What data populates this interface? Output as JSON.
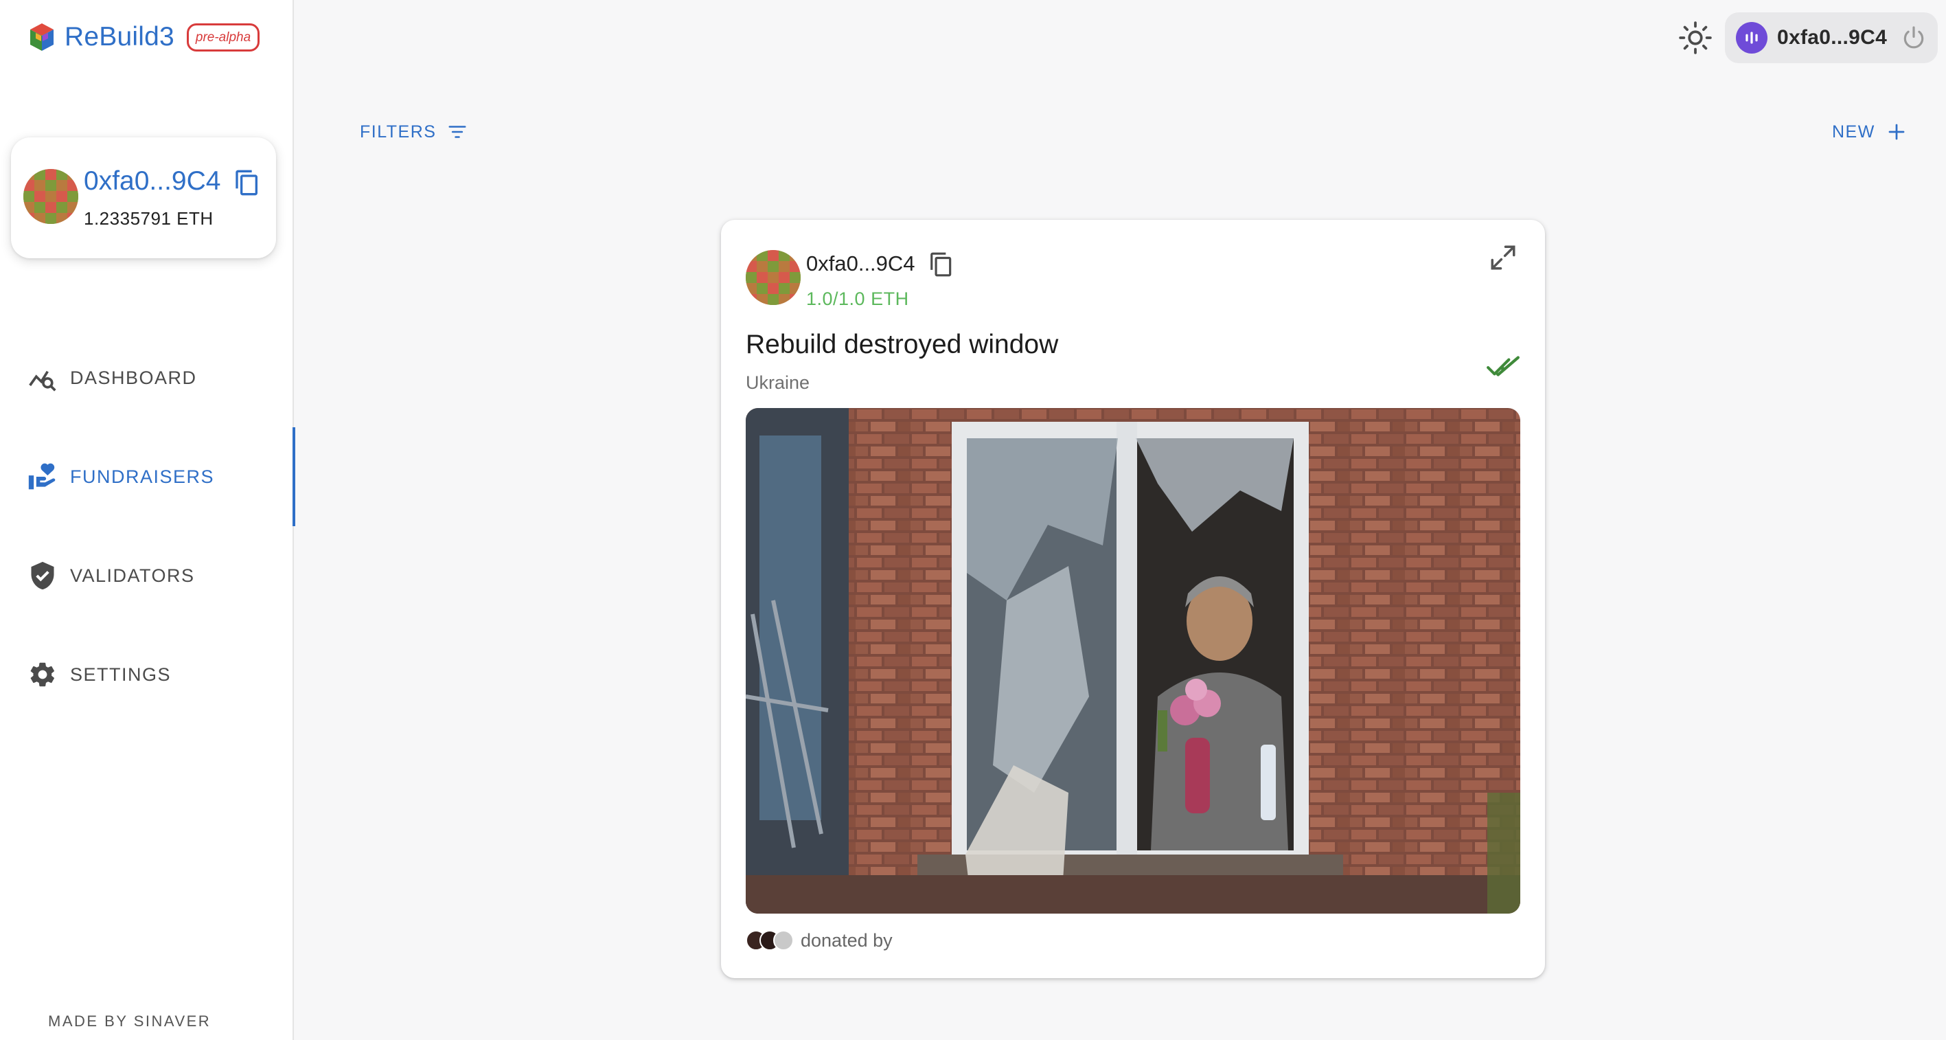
{
  "app": {
    "name": "ReBuild3",
    "badge": "pre-alpha"
  },
  "sidebar": {
    "wallet": {
      "address": "0xfa0...9C4",
      "balance": "1.2335791 ETH"
    },
    "items": [
      {
        "label": "DASHBOARD",
        "icon": "chart-search-icon",
        "active": false
      },
      {
        "label": "FUNDRAISERS",
        "icon": "hand-heart-icon",
        "active": true
      },
      {
        "label": "VALIDATORS",
        "icon": "shield-check-icon",
        "active": false
      },
      {
        "label": "SETTINGS",
        "icon": "gear-icon",
        "active": false
      }
    ],
    "footer": "MADE BY SINAVER"
  },
  "topbar": {
    "account": "0xfa0...9C4",
    "theme_icon": "sun-icon",
    "account_icon": "wallet-connect-icon",
    "power_icon": "power-icon"
  },
  "toolbar": {
    "filters_label": "FILTERS",
    "new_label": "NEW"
  },
  "card": {
    "owner": "0xfa0...9C4",
    "progress": "1.0/1.0 ETH",
    "progress_fraction": 1.0,
    "title": "Rebuild destroyed window",
    "location": "Ukraine",
    "donated_label": "donated by",
    "donor_count": 3,
    "verified_icon": "double-check-icon"
  },
  "colors": {
    "accent": "#2f6fc7",
    "badge": "#d83b3b",
    "success": "#5cb85c",
    "wallet_icon": "#6f4bd8"
  }
}
